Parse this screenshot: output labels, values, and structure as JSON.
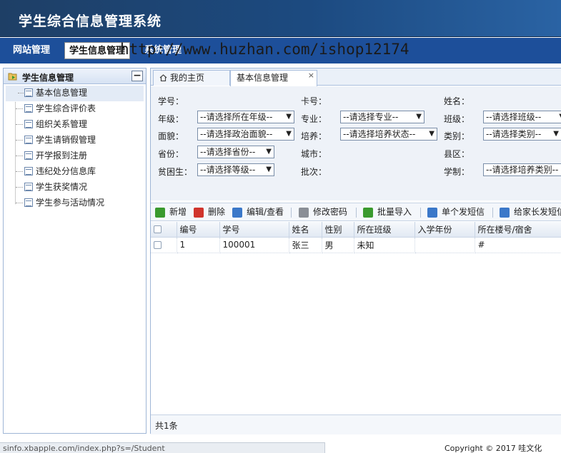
{
  "header": {
    "title": "学生综合信息管理系统"
  },
  "topnav": {
    "items": [
      "网站管理",
      "学生信息管理",
      "系统管理"
    ]
  },
  "watermark": "http://www.huzhan.com/ishop12174",
  "sidebar": {
    "title": "学生信息管理",
    "collapse_symbol": "−",
    "items": [
      "基本信息管理",
      "学生综合评价表",
      "组织关系管理",
      "学生请销假管理",
      "开学报到注册",
      "违纪处分信息库",
      "学生获奖情况",
      "学生参与活动情况"
    ]
  },
  "tabs": {
    "home": "我的主页",
    "active": "基本信息管理",
    "close": "×"
  },
  "form": {
    "xuehao": "学号：",
    "kahao": "卡号：",
    "xingming": "姓名：",
    "nianji": "年级：",
    "nianji_sel": "--请选择所在年级--",
    "zhuanye": "专业：",
    "zhuanye_sel": "--请选择专业--",
    "banji": "班级：",
    "banji_sel": "--请选择班级--",
    "mianmao": "面貌：",
    "mianmao_sel": "--请选择政治面貌--",
    "peiyang": "培养：",
    "peiyang_sel": "--请选择培养状态--",
    "leibie": "类别：",
    "leibie_sel": "--请选择类别--",
    "shengfen": "省份：",
    "shengfen_sel": "--请选择省份--",
    "chengshi": "城市：",
    "xianqu": "县区：",
    "pinkun": "贫困生：",
    "pinkun_sel": "--请选择等级--",
    "pici": "批次：",
    "xuezhi": "学制：",
    "xuezhi_sel": "--请选择培养类别--",
    "arrow": "▼"
  },
  "toolbar": {
    "add": "新增",
    "delete": "删除",
    "edit": "编辑/查看",
    "password": "修改密码",
    "import": "批量导入",
    "sms": "单个发短信",
    "parent_sms": "给家长发短信"
  },
  "table": {
    "headers": [
      "编号",
      "学号",
      "姓名",
      "性别",
      "所在班级",
      "入学年份",
      "所在楼号/宿舍"
    ],
    "rows": [
      [
        "1",
        "100001",
        "张三",
        "男",
        "未知",
        "",
        "#"
      ]
    ]
  },
  "footer": {
    "count": "共1条"
  },
  "statusbar": {
    "url": "sinfo.xbapple.com/index.php?s=/Student"
  },
  "copyright": "Copyright © 2017 哇文化",
  "colors": {
    "header": "#1e3f66",
    "nav": "#1d4f9a",
    "panel": "#eef2f8"
  }
}
